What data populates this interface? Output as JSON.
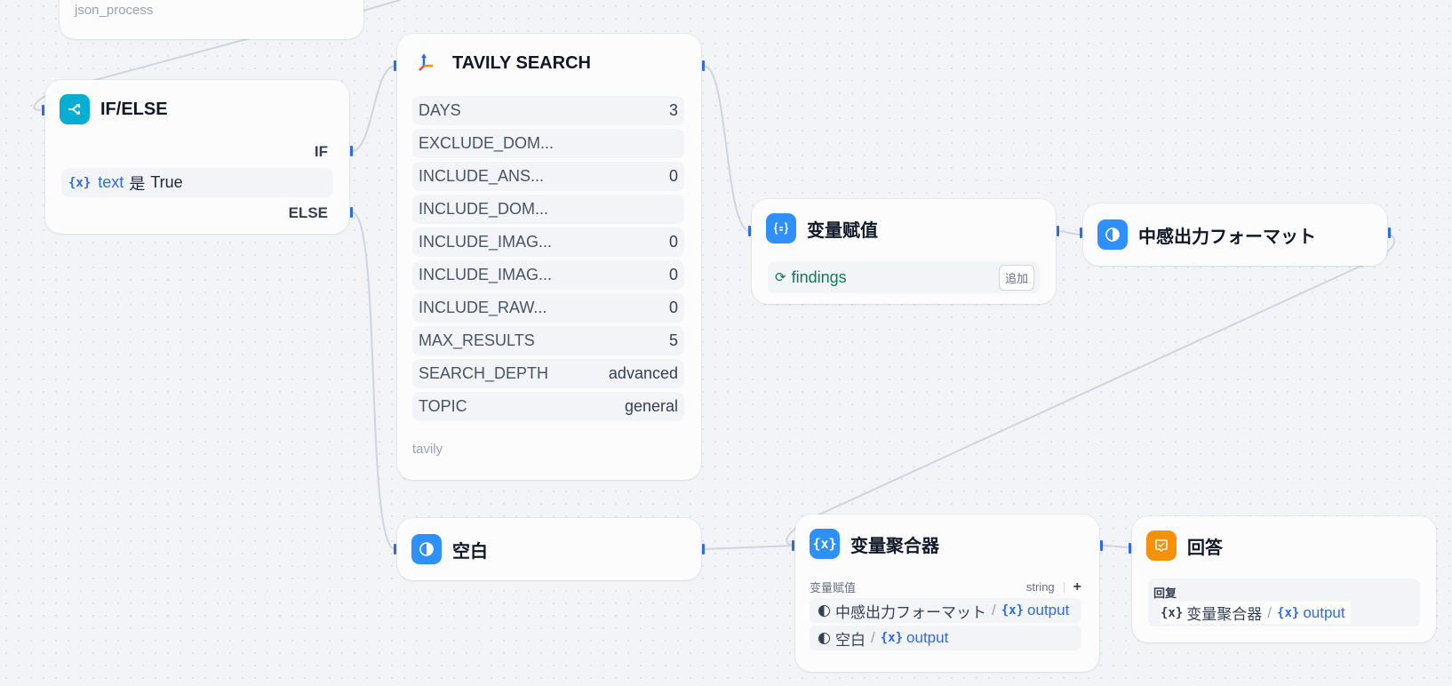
{
  "canvas": {
    "edge_color": "#d0d5dd",
    "handle_color": "#2e6be6"
  },
  "json_process": {
    "label": "json_process"
  },
  "ifelse": {
    "title": "IF/ELSE",
    "icon": "branch-icon",
    "color": "#06aed4",
    "if_label": "IF",
    "else_label": "ELSE",
    "condition": {
      "variable": "text",
      "operator": "是",
      "value": "True"
    }
  },
  "tavily": {
    "title": "TAVILY SEARCH",
    "icon": "tavily-logo-icon",
    "params": [
      {
        "name": "DAYS",
        "value": "3"
      },
      {
        "name": "EXCLUDE_DOM...",
        "value": ""
      },
      {
        "name": "INCLUDE_ANS...",
        "value": "0"
      },
      {
        "name": "INCLUDE_DOM...",
        "value": ""
      },
      {
        "name": "INCLUDE_IMAG...",
        "value": "0"
      },
      {
        "name": "INCLUDE_IMAG...",
        "value": "0"
      },
      {
        "name": "INCLUDE_RAW...",
        "value": "0"
      },
      {
        "name": "MAX_RESULTS",
        "value": "5"
      },
      {
        "name": "SEARCH_DEPTH",
        "value": "advanced"
      },
      {
        "name": "TOPIC",
        "value": "general"
      }
    ],
    "footer": "tavily"
  },
  "assign": {
    "title": "变量赋值",
    "icon": "assign-icon",
    "color": "#2e90fa",
    "variable": "findings",
    "mode": "追加"
  },
  "format": {
    "title": "中感出力フォーマット",
    "icon": "half-circle-icon",
    "color": "#2e90fa"
  },
  "blank": {
    "title": "空白",
    "icon": "half-circle-icon",
    "color": "#2e90fa"
  },
  "aggregator": {
    "title": "变量聚合器",
    "icon": "variable-icon",
    "color": "#2e90fa",
    "group_label": "变量赋值",
    "type": "string",
    "add": "+",
    "items": [
      {
        "node": "中感出力フォーマット",
        "var": "output"
      },
      {
        "node": "空白",
        "var": "output"
      }
    ]
  },
  "answer": {
    "title": "回答",
    "icon": "answer-icon",
    "color": "#f79009",
    "label": "回复",
    "ref_node": "变量聚合器",
    "ref_var": "output"
  }
}
